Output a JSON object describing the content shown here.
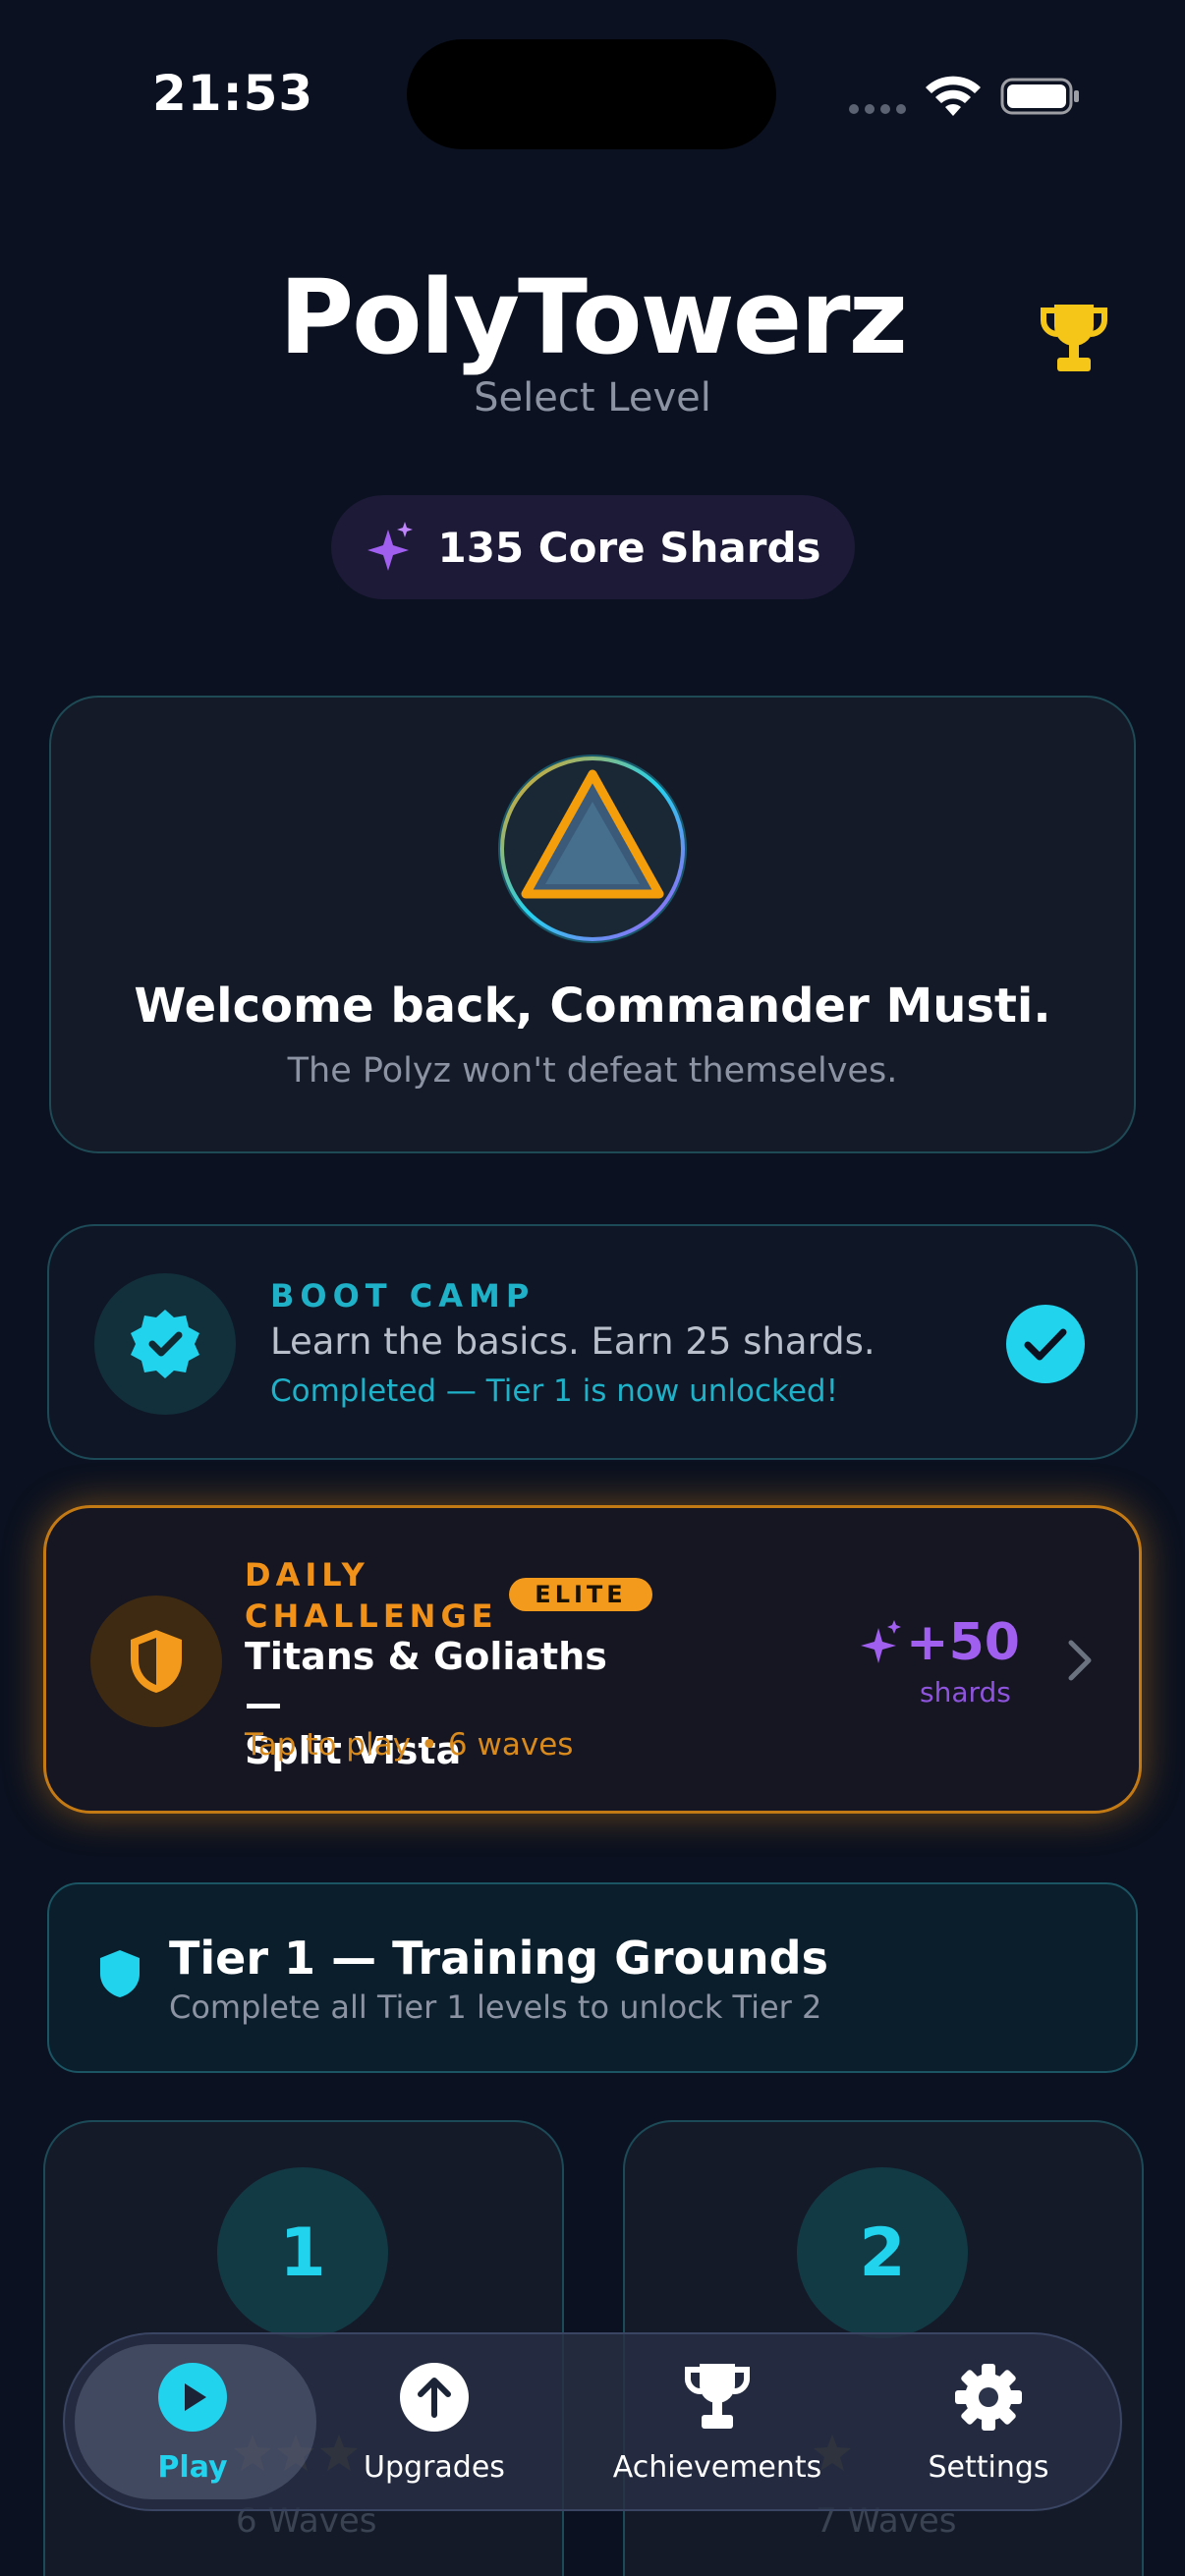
{
  "status_bar": {
    "time": "21:53"
  },
  "header": {
    "title": "PolyTowerz",
    "subtitle": "Select Level",
    "shards_label": "135 Core Shards"
  },
  "welcome": {
    "title": "Welcome back, Commander Musti.",
    "subtitle": "The Polyz won't defeat themselves."
  },
  "boot_camp": {
    "label": "BOOT CAMP",
    "description": "Learn the basics. Earn 25 shards.",
    "status": "Completed — Tier 1 is now unlocked!"
  },
  "daily_challenge": {
    "label_line1": "DAILY",
    "label_line2": "CHALLENGE",
    "badge": "ELITE",
    "name_line1": "Titans & Goliaths —",
    "name_line2": "Split Vista",
    "meta": "Tap to play • 6 waves",
    "reward": "+50",
    "reward_unit": "shards"
  },
  "tier": {
    "title": "Tier 1 — Training Grounds",
    "subtitle": "Complete all Tier 1 levels to unlock Tier 2"
  },
  "levels": [
    {
      "number": "1",
      "waves": "6 Waves"
    },
    {
      "number": "2",
      "waves": "7 Waves"
    }
  ],
  "tabs": [
    {
      "label": "Play"
    },
    {
      "label": "Upgrades"
    },
    {
      "label": "Achievements"
    },
    {
      "label": "Settings"
    }
  ],
  "colors": {
    "background": "#0b1120",
    "accent_cyan": "#22d3ee",
    "accent_orange": "#f39a1c",
    "accent_purple": "#a15ff0",
    "trophy_gold": "#f5c518"
  }
}
